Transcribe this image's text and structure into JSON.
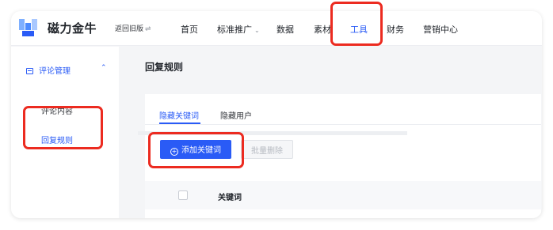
{
  "app": {
    "brand": "磁力金牛",
    "back_to_old": "返回旧版",
    "back_to_old_icon": "swap-icon"
  },
  "topnav": {
    "items": [
      {
        "label": "首页"
      },
      {
        "label": "标准推广",
        "has_dropdown": true
      },
      {
        "label": "数据"
      },
      {
        "label": "素材"
      },
      {
        "label": "工具",
        "active": true
      },
      {
        "label": "财务"
      },
      {
        "label": "营销中心"
      }
    ]
  },
  "sidebar": {
    "group": {
      "label": "评论管理",
      "icon": "comment-icon",
      "expanded": true
    },
    "items": [
      {
        "label": "评论内容"
      },
      {
        "label": "回复规则",
        "active": true
      }
    ]
  },
  "main": {
    "title": "回复规则",
    "tabs": [
      {
        "label": "隐藏关键词",
        "active": true
      },
      {
        "label": "隐藏用户"
      }
    ],
    "add_button": "添加关键词",
    "batch_delete_button": "批量删除",
    "table": {
      "columns": [
        "关键词"
      ]
    }
  },
  "colors": {
    "accent": "#2a5bf6",
    "highlight": "#ec2b20"
  }
}
